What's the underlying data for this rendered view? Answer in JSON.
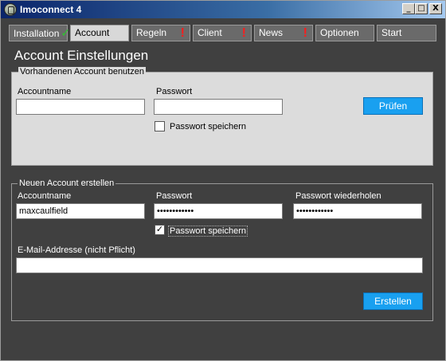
{
  "window": {
    "title": "Imoconnect 4",
    "min_glyph": "_",
    "max_glyph": "□",
    "close_glyph": "X"
  },
  "tabs": [
    {
      "label": "Installation",
      "status": "✓"
    },
    {
      "label": "Account",
      "status": ""
    },
    {
      "label": "Regeln",
      "status": "!"
    },
    {
      "label": "Client",
      "status": "!"
    },
    {
      "label": "News",
      "status": "!"
    },
    {
      "label": "Optionen",
      "status": ""
    },
    {
      "label": "Start",
      "status": ""
    }
  ],
  "page": {
    "title": "Account Einstellungen"
  },
  "existing": {
    "legend": "Vorhandenen Account benutzen",
    "account_label": "Accountname",
    "account_value": "",
    "password_label": "Passwort",
    "password_value": "",
    "save_password_label": "Passwort speichern",
    "save_password_checked": "",
    "check_button": "Prüfen"
  },
  "new_account": {
    "legend": "Neuen Account erstellen",
    "account_label": "Accountname",
    "account_value": "maxcaulfield",
    "password_label": "Passwort",
    "password_value": "••••••••••••",
    "password_repeat_label": "Passwort wiederholen",
    "password_repeat_value": "••••••••••••",
    "save_password_label": "Passwort speichern",
    "save_password_checked": "✓",
    "email_label": "E-Mail-Addresse (nicht Pflicht)",
    "email_value": "",
    "create_button": "Erstellen"
  },
  "colors": {
    "accent": "#19a0f0",
    "alert": "#ff1a1a",
    "ok": "#2cc82c",
    "background": "#404040"
  }
}
